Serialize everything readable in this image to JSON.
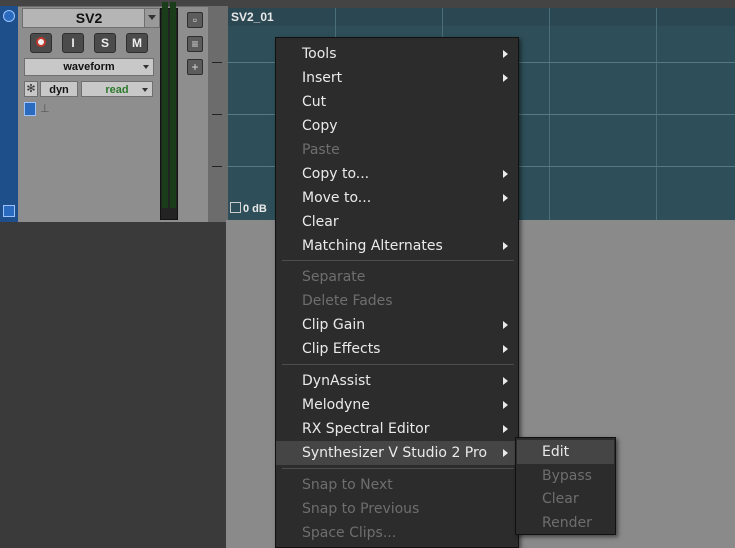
{
  "track": {
    "name": "SV2",
    "buttons": {
      "record": "",
      "input": "I",
      "solo": "S",
      "mute": "M"
    },
    "view_selector": "waveform",
    "automation_label": "dyn",
    "automation_mode": "read"
  },
  "clip": {
    "name": "SV2_01",
    "gain": "0 dB"
  },
  "context_menu": {
    "items": [
      {
        "label": "Tools",
        "submenu": true,
        "enabled": true
      },
      {
        "label": "Insert",
        "submenu": true,
        "enabled": true
      },
      {
        "label": "Cut",
        "submenu": false,
        "enabled": true
      },
      {
        "label": "Copy",
        "submenu": false,
        "enabled": true
      },
      {
        "label": "Paste",
        "submenu": false,
        "enabled": false
      },
      {
        "label": "Copy to...",
        "submenu": true,
        "enabled": true
      },
      {
        "label": "Move to...",
        "submenu": true,
        "enabled": true
      },
      {
        "label": "Clear",
        "submenu": false,
        "enabled": true
      },
      {
        "label": "Matching Alternates",
        "submenu": true,
        "enabled": true
      },
      {
        "label": "Separate",
        "submenu": false,
        "enabled": false
      },
      {
        "label": "Delete Fades",
        "submenu": false,
        "enabled": false
      },
      {
        "label": "Clip Gain",
        "submenu": true,
        "enabled": true
      },
      {
        "label": "Clip Effects",
        "submenu": true,
        "enabled": true
      },
      {
        "label": "DynAssist",
        "submenu": true,
        "enabled": true
      },
      {
        "label": "Melodyne",
        "submenu": true,
        "enabled": true
      },
      {
        "label": "RX Spectral Editor",
        "submenu": true,
        "enabled": true
      },
      {
        "label": "Synthesizer V Studio 2 Pro",
        "submenu": true,
        "enabled": true,
        "highlighted": true
      },
      {
        "label": "Snap to Next",
        "submenu": false,
        "enabled": false
      },
      {
        "label": "Snap to Previous",
        "submenu": false,
        "enabled": false
      },
      {
        "label": "Space Clips...",
        "submenu": false,
        "enabled": false
      }
    ]
  },
  "submenu": {
    "items": [
      {
        "label": "Edit",
        "enabled": true,
        "highlighted": true
      },
      {
        "label": "Bypass",
        "enabled": false
      },
      {
        "label": "Clear",
        "enabled": false
      },
      {
        "label": "Render",
        "enabled": false
      }
    ]
  },
  "colors": {
    "menu_bg": "#2c2c2c",
    "menu_highlight": "#454545",
    "clip_bg": "#2e4f59",
    "automation_mode_text": "#2d7a2d"
  }
}
